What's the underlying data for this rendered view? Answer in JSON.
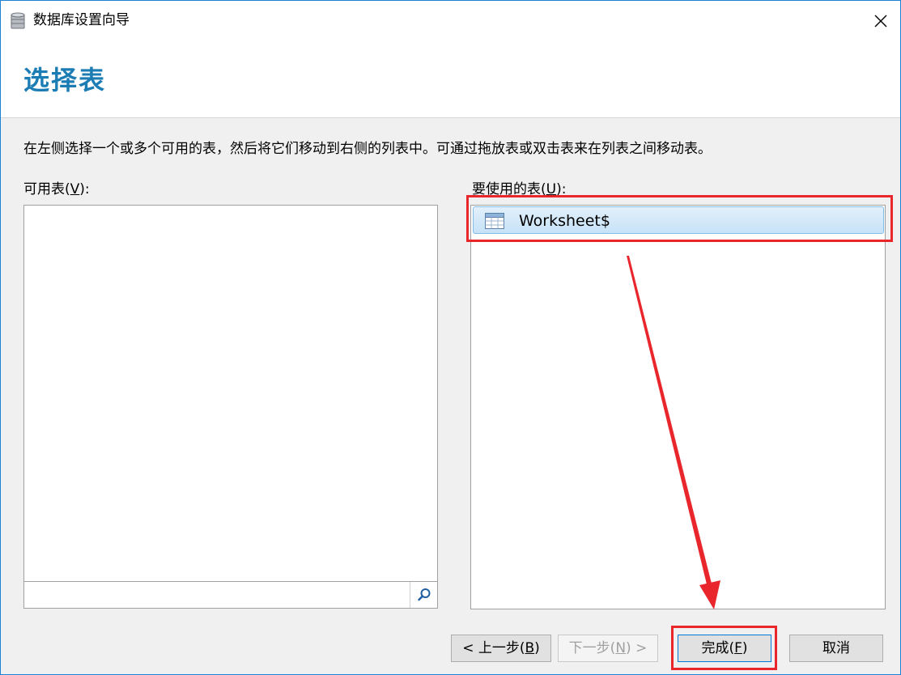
{
  "window": {
    "title": "数据库设置向导",
    "close_glyph": "✕"
  },
  "header": {
    "title": "选择表"
  },
  "instruction": "在左侧选择一个或多个可用的表，然后将它们移动到右侧的列表中。可通过拖放表或双击表来在列表之间移动表。",
  "available_tables": {
    "label_prefix": "可用表(",
    "label_hotkey": "V",
    "label_suffix": "):",
    "items": [],
    "search_placeholder": ""
  },
  "used_tables": {
    "label_prefix": "要使用的表(",
    "label_hotkey": "U",
    "label_suffix": "):",
    "items": [
      {
        "label": "Worksheet$",
        "icon": "table-icon",
        "selected": true
      }
    ]
  },
  "buttons": {
    "back": {
      "prefix": "< 上一步(",
      "hotkey": "B",
      "suffix": ")"
    },
    "next": {
      "prefix": "下一步(",
      "hotkey": "N",
      "suffix": ") >"
    },
    "finish": {
      "prefix": "完成(",
      "hotkey": "F",
      "suffix": ")"
    },
    "cancel": "取消"
  },
  "annotation": {
    "color": "#e8262b"
  },
  "colors": {
    "accent": "#1c7cb4",
    "window_border": "#1883d7",
    "selection": "#c6e2f7"
  }
}
